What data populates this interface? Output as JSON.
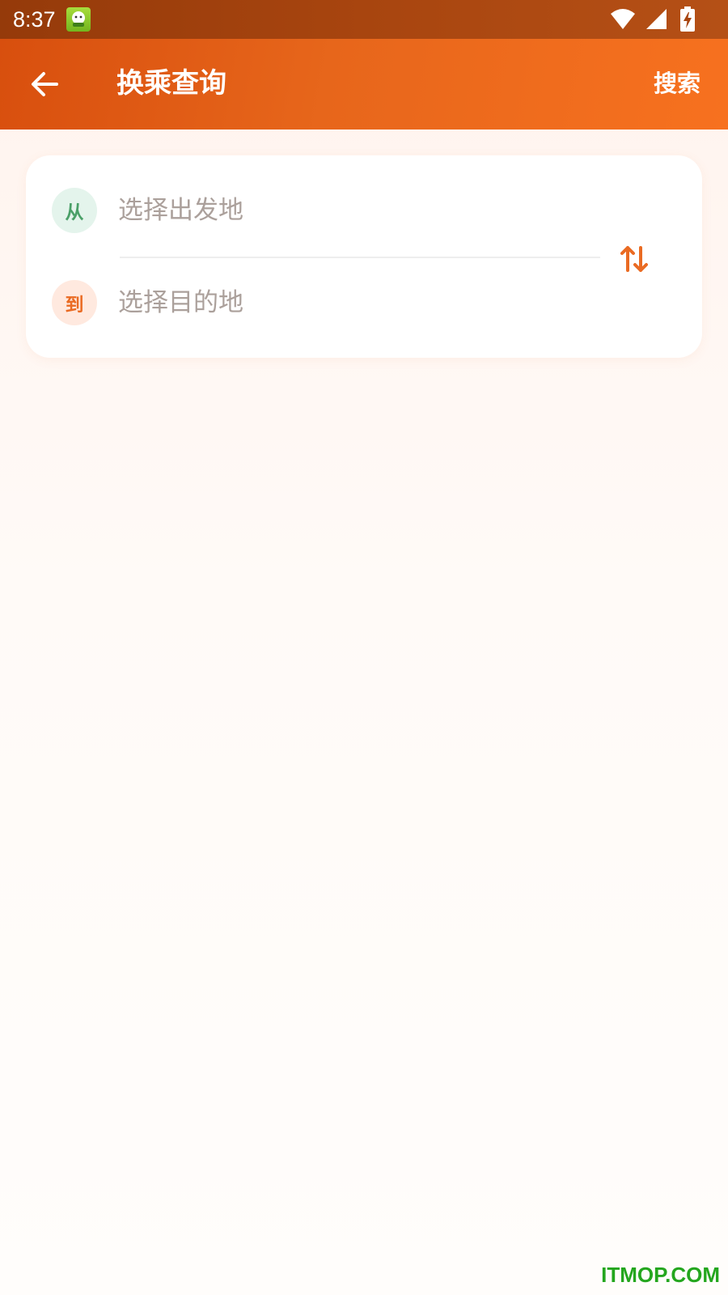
{
  "status_bar": {
    "time": "8:37",
    "icons": [
      "app-notification-icon",
      "wifi-icon",
      "cell-signal-icon",
      "battery-charging-icon"
    ]
  },
  "header": {
    "back_icon": "arrow-left-icon",
    "title": "换乘查询",
    "search_label": "搜索"
  },
  "route": {
    "from": {
      "marker": "从",
      "placeholder": "选择出发地"
    },
    "to": {
      "marker": "到",
      "placeholder": "选择目的地"
    },
    "swap_icon": "swap-vertical-icon"
  },
  "watermark": "ITMOP.COM",
  "colors": {
    "header_start": "#d84f0e",
    "header_end": "#f7711f",
    "accent_orange": "#ea6b23",
    "accent_green": "#4aa068",
    "placeholder_text": "#aba09b"
  }
}
